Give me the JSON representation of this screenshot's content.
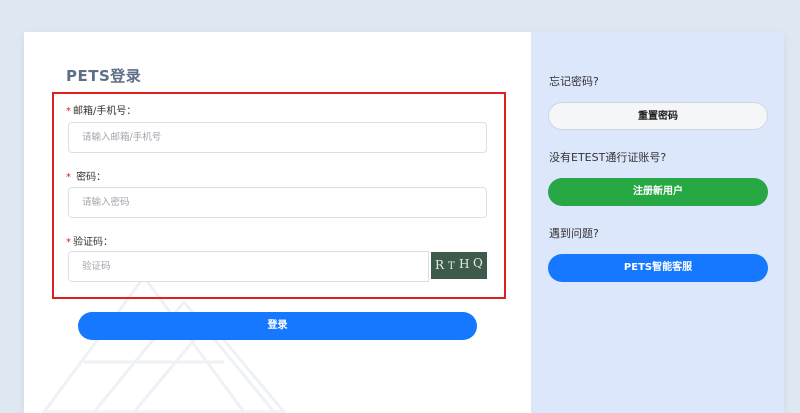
{
  "login": {
    "title": "PETS登录",
    "email": {
      "required_mark": "*",
      "label": "邮箱/手机号：",
      "placeholder": "请输入邮箱/手机号"
    },
    "password": {
      "required_mark": "*",
      "label": " 密码：",
      "placeholder": "请输入密码"
    },
    "captcha": {
      "required_mark": "*",
      "label": "验证码：",
      "placeholder": "验证码",
      "image_text": "RTHQ"
    },
    "submit_label": "登录"
  },
  "sidebar": {
    "forgot_label": "忘记密码?",
    "reset_button": "重置密码",
    "no_account_label": "没有ETEST通行证账号?",
    "register_button": "注册新用户",
    "help_label": "遇到问题?",
    "service_button": "PETS智能客服"
  },
  "colors": {
    "primary": "#1677ff",
    "success": "#28a745",
    "error_border": "#e02020",
    "sidebar_bg": "#dde7fb"
  }
}
